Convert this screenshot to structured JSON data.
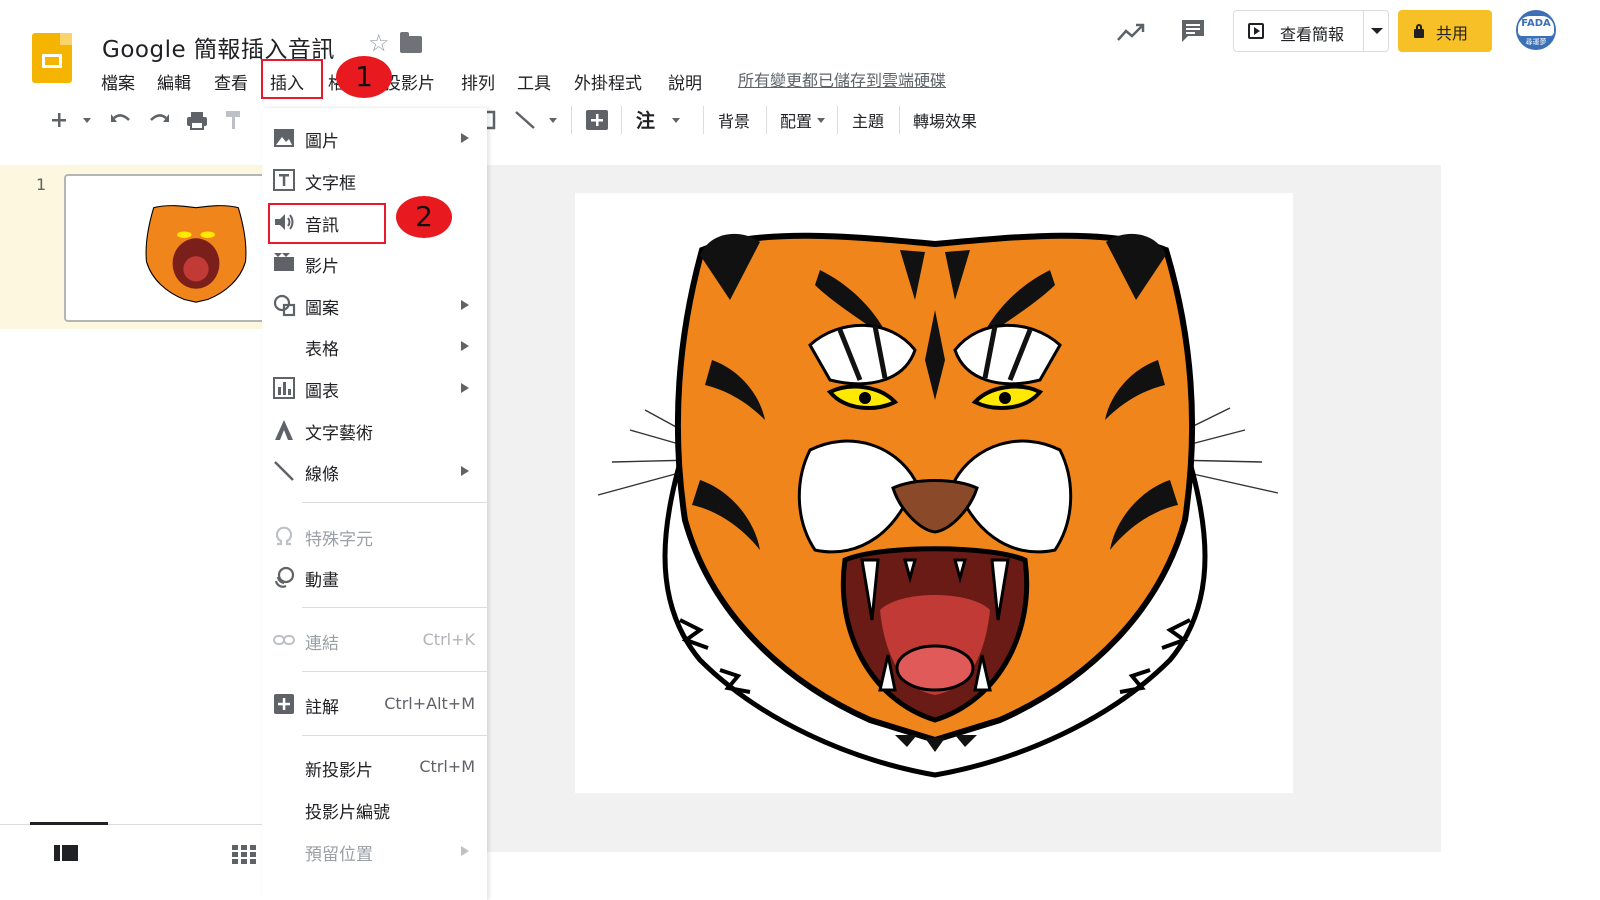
{
  "header": {
    "title": "Google 簡報插入音訊",
    "menu": [
      "檔案",
      "編輯",
      "查看",
      "插入",
      "格",
      "投影片",
      "排列",
      "工具",
      "外掛程式",
      "說明"
    ],
    "save_status": "所有變更都已儲存到雲端硬碟",
    "present_label": "查看簡報",
    "share_label": "共用",
    "avatar_text": "FADA",
    "avatar_sub": "尋運夢"
  },
  "callouts": {
    "step1": "1",
    "step2": "2"
  },
  "toolbar": {
    "comment_label": "注",
    "background_label": "背景",
    "layout_label": "配置",
    "theme_label": "主題",
    "transition_label": "轉場效果"
  },
  "filmstrip": {
    "slide_number": "1"
  },
  "insert_menu": {
    "items": [
      {
        "label": "圖片",
        "submenu": true
      },
      {
        "label": "文字框"
      },
      {
        "label": "音訊"
      },
      {
        "label": "影片"
      },
      {
        "label": "圖案",
        "submenu": true
      },
      {
        "label": "表格",
        "submenu": true
      },
      {
        "label": "圖表",
        "submenu": true
      },
      {
        "label": "文字藝術"
      },
      {
        "label": "線條",
        "submenu": true
      },
      {
        "label": "特殊字元",
        "disabled": true
      },
      {
        "label": "動畫"
      },
      {
        "label": "連結",
        "shortcut": "Ctrl+K",
        "disabled": true
      },
      {
        "label": "註解",
        "shortcut": "Ctrl+Alt+M"
      },
      {
        "label": "新投影片",
        "shortcut": "Ctrl+M"
      },
      {
        "label": "投影片編號"
      },
      {
        "label": "預留位置",
        "submenu": true,
        "disabled": true
      }
    ]
  },
  "colors": {
    "accent_yellow": "#f6c026",
    "logo_yellow": "#f4b400",
    "highlight_red": "#e8192c",
    "tiger_orange": "#f0861b"
  },
  "icons": {
    "logo": "slides-logo-icon",
    "star": "star-icon",
    "folder": "folder-icon",
    "trend": "activity-trend-icon",
    "comment": "comment-icon"
  }
}
